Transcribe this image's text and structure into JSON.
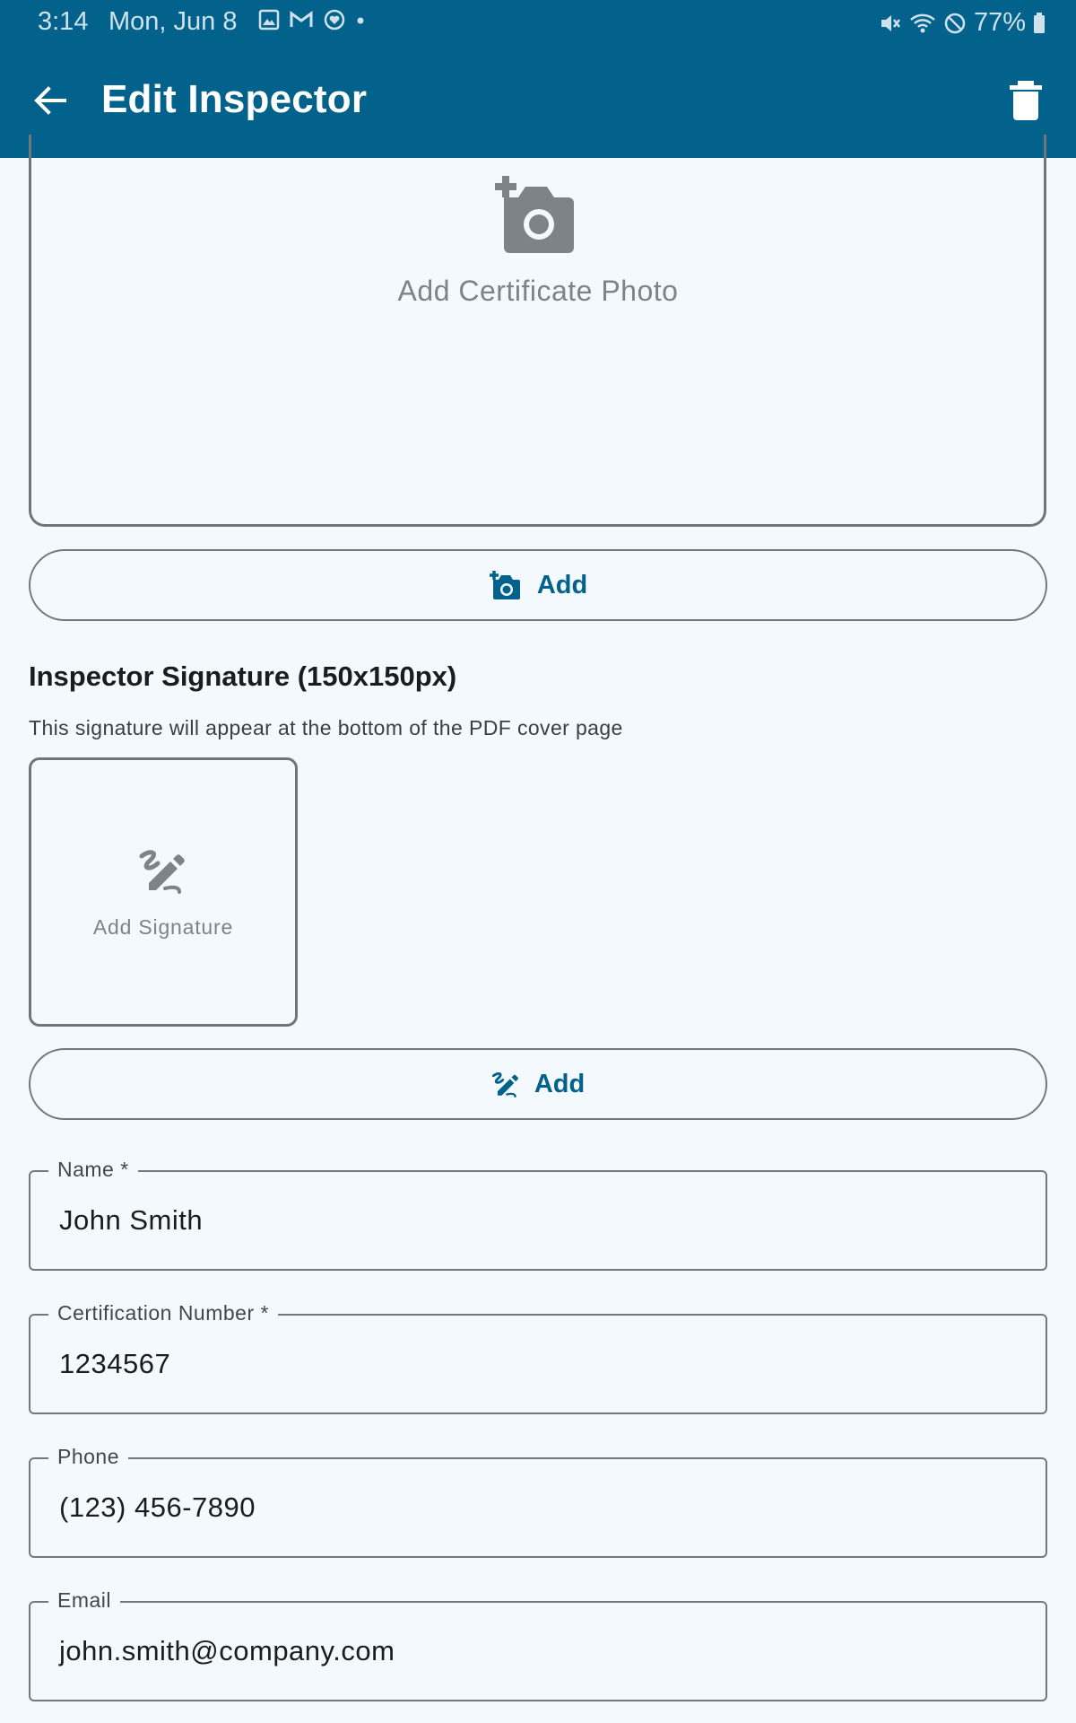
{
  "status_bar": {
    "time": "3:14",
    "date": "Mon, Jun 8",
    "battery": "77%"
  },
  "app_bar": {
    "title": "Edit Inspector",
    "color": "#02628b"
  },
  "certificate_photo": {
    "placeholder_label": "Add Certificate Photo",
    "add_button_label": "Add"
  },
  "signature": {
    "section_title": "Inspector Signature (150x150px)",
    "description": "This signature will appear at the bottom of the PDF cover page",
    "placeholder_label": "Add Signature",
    "add_button_label": "Add"
  },
  "fields": {
    "name": {
      "label": "Name *",
      "value": "John Smith"
    },
    "certification_number": {
      "label": "Certification Number *",
      "value": "1234567"
    },
    "phone": {
      "label": "Phone",
      "value": "(123) 456-7890"
    },
    "email": {
      "label": "Email",
      "value": "john.smith@company.com"
    }
  },
  "icons": {
    "back": "arrow-back-icon",
    "delete": "trash-icon",
    "add_photo": "add-a-photo-icon",
    "signature": "signature-icon"
  }
}
